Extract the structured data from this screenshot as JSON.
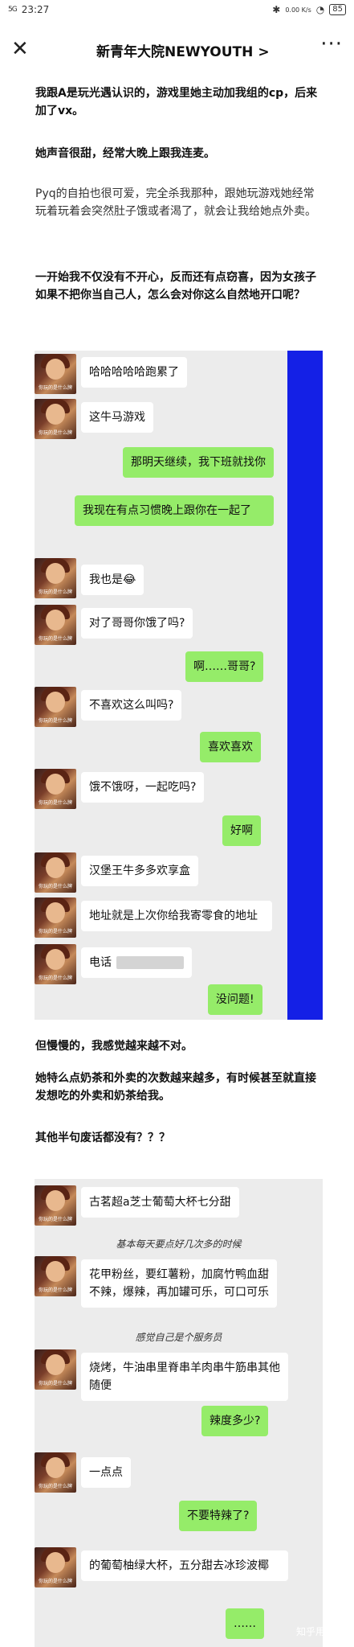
{
  "status": {
    "signal": "5G",
    "time": "23:27",
    "speed": "0.00 K/s",
    "battery": "85"
  },
  "nav": {
    "close_icon": "close-icon",
    "title": "新青年大院NEWYOUTH",
    "chevron": ">",
    "more_icon": "more-icon"
  },
  "paragraphs": {
    "p1": "我跟A是玩光遇认识的，游戏里她主动加我组的cp，后来加了vx。",
    "p2": "她声音很甜，经常大晚上跟我连麦。",
    "p3": "Pyq的自拍也很可爱，完全杀我那种，跟她玩游戏她经常玩着玩着会突然肚子饿或者渴了，就会让我给她点外卖。",
    "p4": "一开始我不仅没有不开心，反而还有点窃喜，因为女孩子如果不把你当自己人，怎么会对你这么自然地开口呢？",
    "p5": "但慢慢的，我感觉越来越不对。",
    "p6": "她特么点奶茶和外卖的次数越来越多，有时候甚至就直接发想吃的外卖和奶茶给我。",
    "p7": "其他半句废话都没有？？？"
  },
  "chat1": {
    "avatar_caption": "你玩的是什么牌",
    "messages": [
      {
        "side": "in",
        "text": "哈哈哈哈哈跑累了"
      },
      {
        "side": "in",
        "text": "这牛马游戏"
      },
      {
        "side": "out",
        "text": "那明天继续，我下班就找你"
      },
      {
        "side": "out",
        "text": "我现在有点习惯晚上跟你在一起了"
      },
      {
        "side": "in",
        "text": "我也是😂"
      },
      {
        "side": "in",
        "text": "对了哥哥你饿了吗?"
      },
      {
        "side": "out",
        "text": "啊……哥哥?"
      },
      {
        "side": "in",
        "text": "不喜欢这么叫吗?"
      },
      {
        "side": "out",
        "text": "喜欢喜欢"
      },
      {
        "side": "in",
        "text": "饿不饿呀，一起吃吗?"
      },
      {
        "side": "out",
        "text": "好啊"
      },
      {
        "side": "in",
        "text": "汉堡王牛多多欢享盒"
      },
      {
        "side": "in",
        "text": "地址就是上次你给我寄零食的地址"
      },
      {
        "side": "in",
        "text": "电话"
      },
      {
        "side": "out",
        "text": "没问题!"
      }
    ]
  },
  "chat2": {
    "messages": [
      {
        "side": "in",
        "text": "古茗超a芝士葡萄大杯七分甜"
      },
      {
        "side": "note",
        "text": "基本每天要点好几次多的时候"
      },
      {
        "side": "in",
        "text": "花甲粉丝，要红薯粉，加腐竹鸭血甜不辣，爆辣，再加罐可乐，可口可乐"
      },
      {
        "side": "note",
        "text": "感觉自己是个服务员"
      },
      {
        "side": "in",
        "text": "烧烤，牛油串里脊串羊肉串牛筋串其他随便"
      },
      {
        "side": "out",
        "text": "辣度多少?"
      },
      {
        "side": "in",
        "text": "一点点"
      },
      {
        "side": "out",
        "text": "不要特辣了?"
      },
      {
        "side": "in",
        "text": "的葡萄柚绿大杯，五分甜去冰珍波椰"
      },
      {
        "side": "out",
        "text": "……"
      }
    ]
  },
  "watermark": "知乎用户",
  "colors": {
    "bubble_out": "#95ec69",
    "bubble_in": "#ffffff",
    "chat_bg": "#ececec",
    "blue_bar": "#1420e6"
  }
}
